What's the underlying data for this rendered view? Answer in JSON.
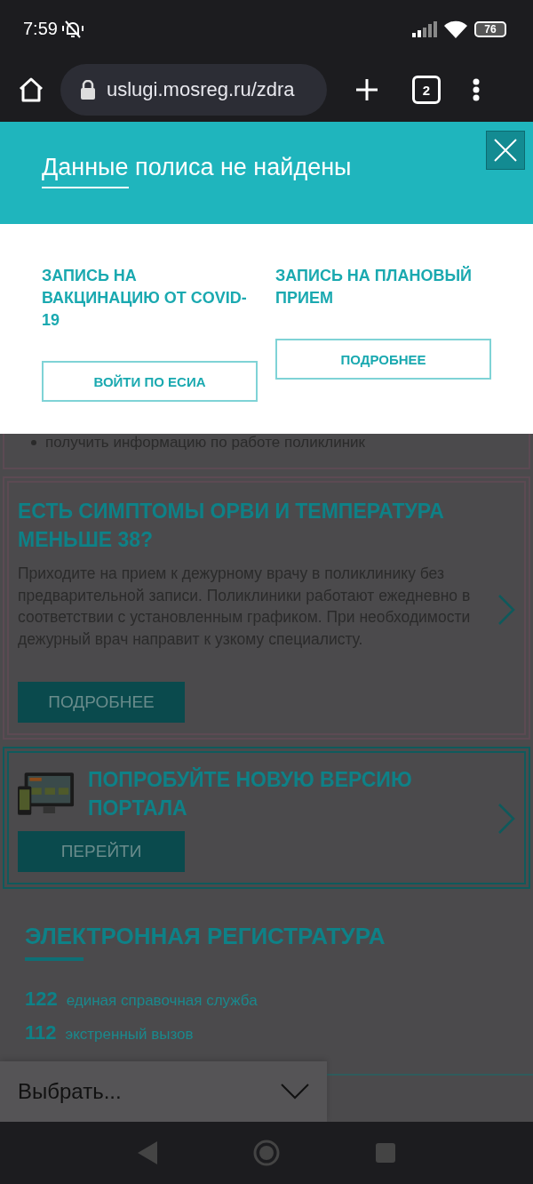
{
  "status_bar": {
    "time": "7:59",
    "battery": "76"
  },
  "browser": {
    "url": "uslugi.mosreg.ru/zdra",
    "tab_count": "2"
  },
  "modal": {
    "title_underlined": "Данные",
    "title_rest": " полиса не найдены",
    "options": [
      {
        "title": "ЗАПИСЬ НА ВАКЦИНАЦИЮ ОТ COVID-19",
        "button": "ВОЙТИ ПО ЕСИА"
      },
      {
        "title": "ЗАПИСЬ НА ПЛАНОВЫЙ ПРИЕМ",
        "button": "ПОДРОБНЕЕ"
      }
    ]
  },
  "page": {
    "notice_bullet": "получить информацию по работе поликлиник",
    "cards": [
      {
        "kind": "info",
        "title": "ЕСТЬ СИМПТОМЫ ОРВИ И ТЕМПЕРАТУРА МЕНЬШЕ 38?",
        "text": "Приходите на прием к дежурному врачу в поликлинику без предварительной записи. Поликлиники работают ежедневно в соответствии с установленным графиком. При необходимости дежурный врач направит к узкому специалисту.",
        "button": "ПОДРОБНЕЕ"
      },
      {
        "kind": "promo",
        "title": "ПОПРОБУЙТЕ НОВУЮ ВЕРСИЮ ПОРТАЛА",
        "button": "ПЕРЕЙТИ"
      }
    ],
    "registry": {
      "title": "ЭЛЕКТРОННАЯ РЕГИСТРАТУРА",
      "phones": [
        {
          "number": "122",
          "label": "единая справочная служба"
        },
        {
          "number": "112",
          "label": "экстренный вызов"
        }
      ]
    }
  },
  "dropdown": {
    "value": "Выбрать..."
  }
}
